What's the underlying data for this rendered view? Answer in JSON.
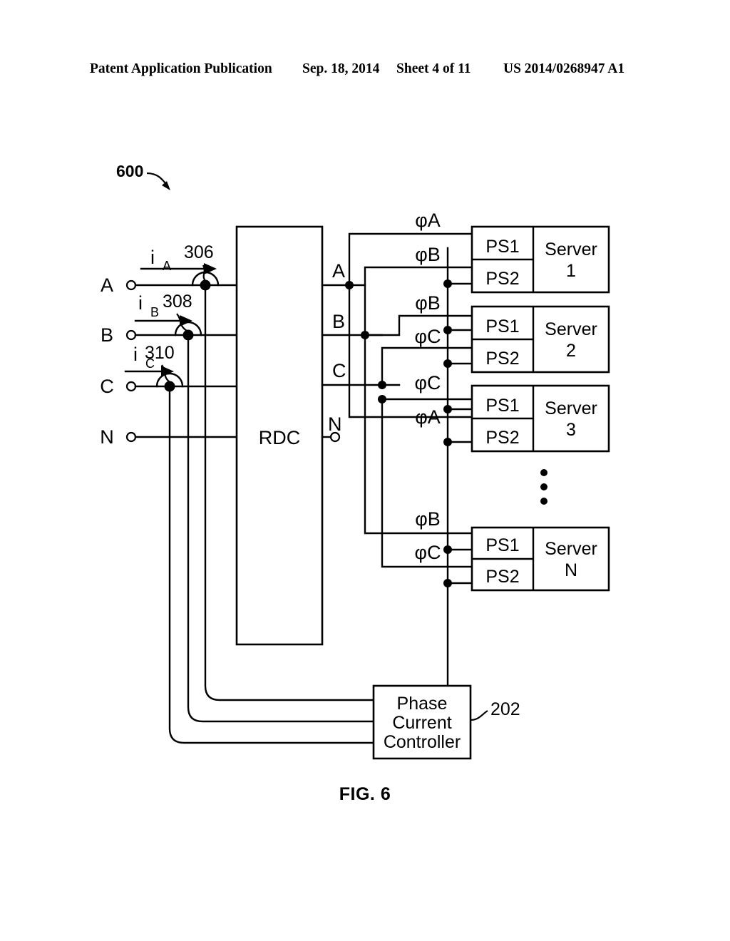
{
  "header": {
    "publication": "Patent Application Publication",
    "date": "Sep. 18, 2014",
    "sheet": "Sheet 4 of 11",
    "patent_number": "US 2014/0268947 A1"
  },
  "figure": {
    "caption": "FIG. 6",
    "figure_reference": "600"
  },
  "diagram": {
    "type": "electrical-schematic",
    "input_terminals": [
      {
        "id": "A",
        "label": "A",
        "current_label": "i",
        "current_sub": "A",
        "sensor_ref": "306"
      },
      {
        "id": "B",
        "label": "B",
        "current_label": "i",
        "current_sub": "B",
        "sensor_ref": "308"
      },
      {
        "id": "C",
        "label": "C",
        "current_label": "i",
        "current_sub": "C",
        "sensor_ref": "310"
      },
      {
        "id": "N",
        "label": "N",
        "current_label": "",
        "current_sub": "",
        "sensor_ref": ""
      }
    ],
    "rdc": {
      "label": "RDC",
      "output_terminals": [
        {
          "label": "A"
        },
        {
          "label": "B"
        },
        {
          "label": "C"
        },
        {
          "label": "N"
        }
      ]
    },
    "phase_labels": [
      {
        "text": "φA"
      },
      {
        "text": "φB"
      },
      {
        "text": "φB"
      },
      {
        "text": "φC"
      },
      {
        "text": "φC"
      },
      {
        "text": "φA"
      },
      {
        "text": "φB"
      },
      {
        "text": "φC"
      }
    ],
    "servers": [
      {
        "name_line1": "Server",
        "name_line2": "1",
        "supplies": [
          {
            "label": "PS1",
            "phase": "φA"
          },
          {
            "label": "PS2",
            "phase": "φB"
          }
        ]
      },
      {
        "name_line1": "Server",
        "name_line2": "2",
        "supplies": [
          {
            "label": "PS1",
            "phase": "φB"
          },
          {
            "label": "PS2",
            "phase": "φC"
          }
        ]
      },
      {
        "name_line1": "Server",
        "name_line2": "3",
        "supplies": [
          {
            "label": "PS1",
            "phase": "φC"
          },
          {
            "label": "PS2",
            "phase": "φA"
          }
        ]
      },
      {
        "name_line1": "Server",
        "name_line2": "N",
        "supplies": [
          {
            "label": "PS1",
            "phase": "φB"
          },
          {
            "label": "PS2",
            "phase": "φC"
          }
        ]
      }
    ],
    "ellipsis": "⋮",
    "controller": {
      "line1": "Phase",
      "line2": "Current",
      "line3": "Controller",
      "reference": "202"
    }
  }
}
